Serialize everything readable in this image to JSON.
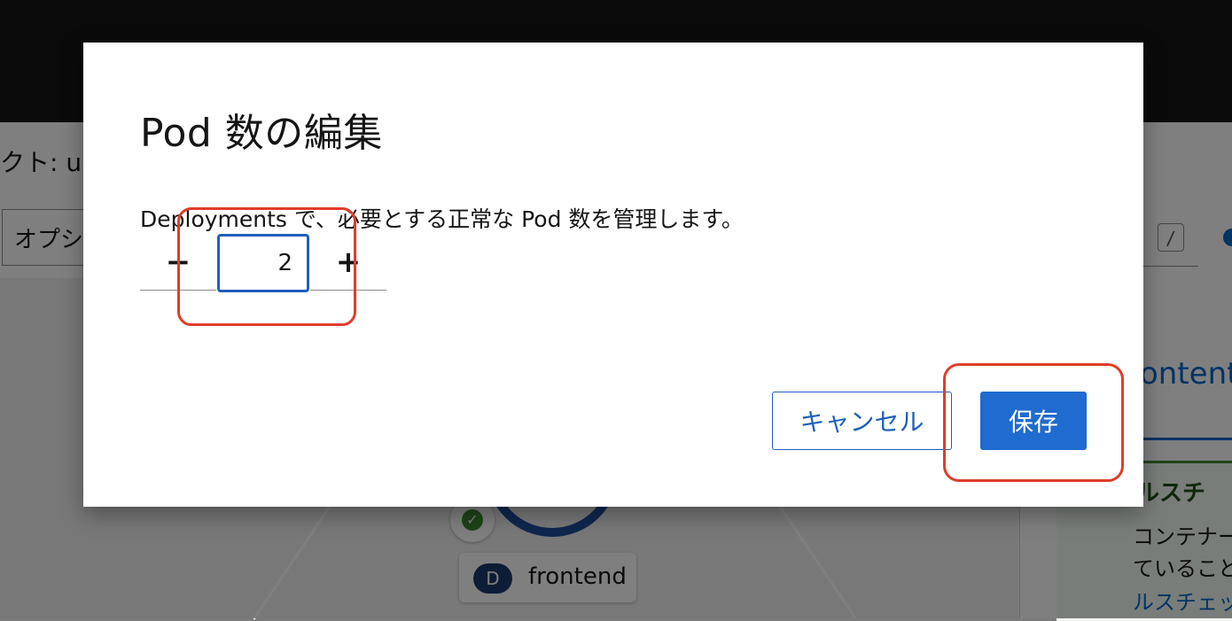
{
  "background": {
    "project_label": "クト: u",
    "options_label": "オプシ",
    "search_shortcut": "/",
    "panel_title": "ontent",
    "alert_title": "ヘルスチ",
    "alert_line1": "コンテナー",
    "alert_line2": "ていること",
    "alert_link": "ルスチェッ",
    "node_badge": "D",
    "node_name": "frontend",
    "status_check": "✓"
  },
  "modal": {
    "title": "Pod 数の編集",
    "description": "Deployments で、必要とする正常な Pod 数を管理します。",
    "stepper": {
      "decrement_label": "−",
      "value": "2",
      "increment_label": "+"
    },
    "cancel_label": "キャンセル",
    "save_label": "保存"
  },
  "colors": {
    "primary": "#1f6bcf",
    "highlight": "#e03d2a",
    "overlay": "rgba(0,0,0,0.5)"
  }
}
